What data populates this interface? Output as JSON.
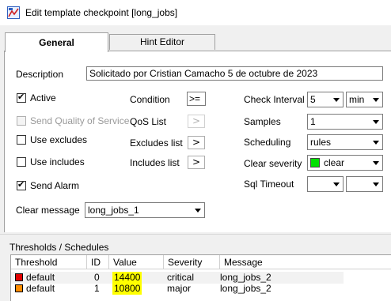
{
  "window": {
    "title": "Edit template checkpoint [long_jobs]"
  },
  "tabs": [
    {
      "label": "General"
    },
    {
      "label": "Hint Editor"
    }
  ],
  "description": {
    "label": "Description",
    "value": "Solicitado por Cristian Camacho 5 de octubre de 2023"
  },
  "checks": {
    "active": {
      "label": "Active",
      "checked": true
    },
    "send_qos": {
      "label": "Send Quality of Service",
      "checked": false,
      "disabled": true
    },
    "use_excludes": {
      "label": "Use excludes",
      "checked": false
    },
    "use_includes": {
      "label": "Use includes",
      "checked": false
    },
    "send_alarm": {
      "label": "Send Alarm",
      "checked": true
    }
  },
  "middle": {
    "condition_label": "Condition",
    "condition_value": ">=",
    "qos_label": "QoS List",
    "excludes_label": "Excludes list",
    "includes_label": "Includes list",
    "btn_glyph": ">"
  },
  "right": {
    "check_interval_label": "Check Interval",
    "check_interval_value": "5",
    "check_interval_unit": "min",
    "samples_label": "Samples",
    "samples_value": "1",
    "scheduling_label": "Scheduling",
    "scheduling_value": "rules",
    "clear_severity_label": "Clear severity",
    "clear_severity_value": "clear",
    "clear_severity_color": "#00e000",
    "sql_timeout_label": "Sql Timeout",
    "sql_timeout_value": "",
    "sql_timeout_unit": ""
  },
  "clear_message": {
    "label": "Clear message",
    "value": "long_jobs_1"
  },
  "thresholds": {
    "section_label": "Thresholds / Schedules",
    "columns": [
      "Threshold Object",
      "ID",
      "Value",
      "Severity",
      "Message"
    ],
    "rows": [
      {
        "object": "default",
        "id": "0",
        "value": "14400",
        "severity": "critical",
        "message": "long_jobs_2",
        "color": "#e00000"
      },
      {
        "object": "default",
        "id": "1",
        "value": "10800",
        "severity": "major",
        "message": "long_jobs_2",
        "color": "#ff8c00"
      }
    ]
  }
}
